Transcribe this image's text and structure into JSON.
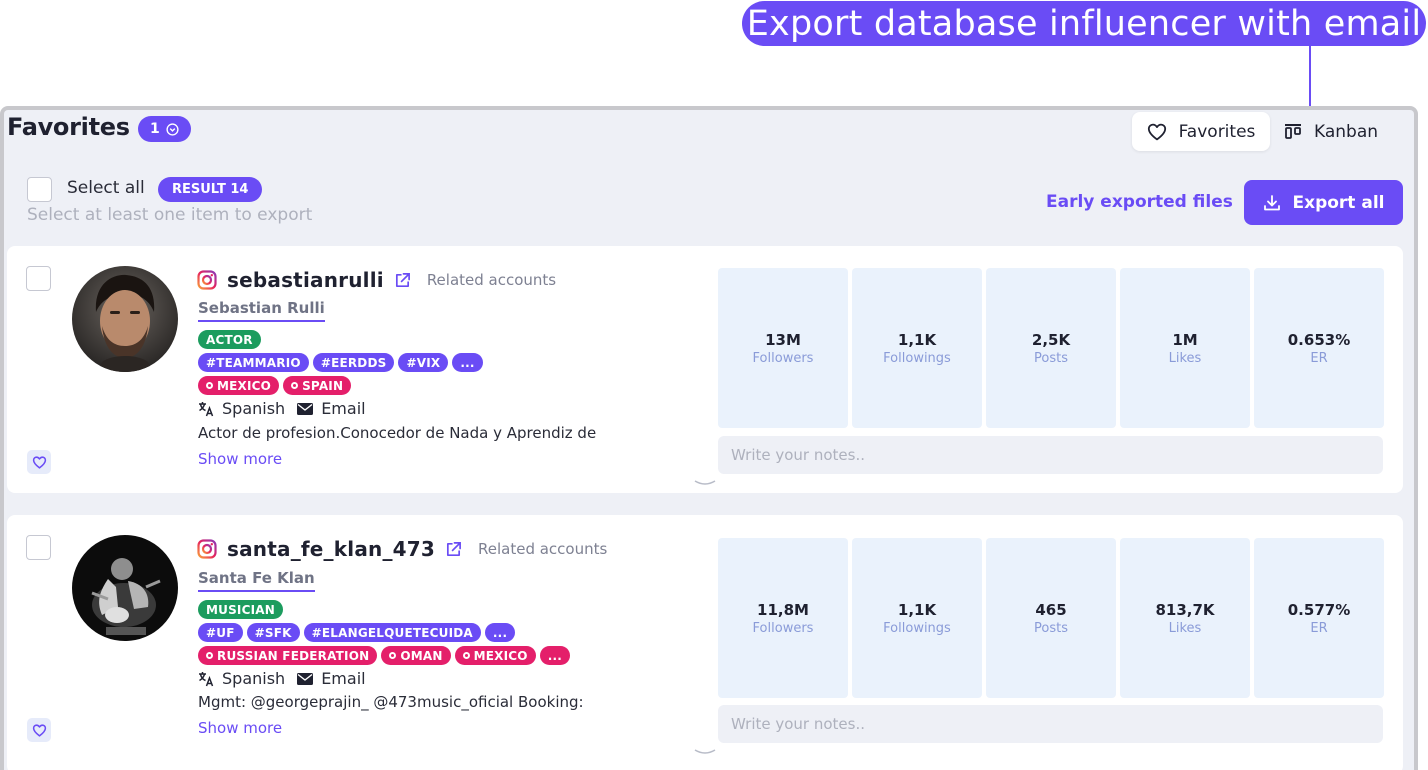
{
  "callout": "Export database influencer with email",
  "header": {
    "title": "Favorites",
    "count": "1",
    "tabs": [
      {
        "label": "Favorites",
        "icon": "heart-icon"
      },
      {
        "label": "Kanban",
        "icon": "kanban-icon"
      }
    ]
  },
  "toolbar": {
    "select_all": "Select all",
    "result": "RESULT 14",
    "hint": "Select at least one item to export",
    "early_exported": "Early exported files",
    "export_all": "Export all"
  },
  "cards": [
    {
      "username": "sebastianrulli",
      "related": "Related accounts",
      "fullname": "Sebastian Rulli",
      "categories": [
        "ACTOR"
      ],
      "hashtags": [
        "#TEAMMARIO",
        "#EERDDS",
        "#VIX",
        "..."
      ],
      "locations": [
        "MEXICO",
        "SPAIN"
      ],
      "language": "Spanish",
      "contact": "Email",
      "bio": "Actor de profesion.Conocedor de Nada y Aprendiz de",
      "show_more": "Show more",
      "stats": [
        {
          "value": "13M",
          "label": "Followers"
        },
        {
          "value": "1,1K",
          "label": "Followings"
        },
        {
          "value": "2,5K",
          "label": "Posts"
        },
        {
          "value": "1M",
          "label": "Likes"
        },
        {
          "value": "0.653%",
          "label": "ER"
        }
      ],
      "notes_placeholder": "Write your notes.."
    },
    {
      "username": "santa_fe_klan_473",
      "related": "Related accounts",
      "fullname": "Santa Fe Klan",
      "categories": [
        "MUSICIAN"
      ],
      "hashtags": [
        "#UF",
        "#SFK",
        "#ELANGELQUETECUIDA",
        "..."
      ],
      "locations": [
        "RUSSIAN FEDERATION",
        "OMAN",
        "MEXICO",
        "..."
      ],
      "language": "Spanish",
      "contact": "Email",
      "bio": "Mgmt: @georgeprajin_ @473music_oficial Booking:",
      "show_more": "Show more",
      "stats": [
        {
          "value": "11,8M",
          "label": "Followers"
        },
        {
          "value": "1,1K",
          "label": "Followings"
        },
        {
          "value": "465",
          "label": "Posts"
        },
        {
          "value": "813,7K",
          "label": "Likes"
        },
        {
          "value": "0.577%",
          "label": "ER"
        }
      ],
      "notes_placeholder": "Write your notes.."
    }
  ],
  "colors": {
    "accent": "#6a4cf5",
    "category": "#1c9c5e",
    "location": "#e41f6a"
  }
}
